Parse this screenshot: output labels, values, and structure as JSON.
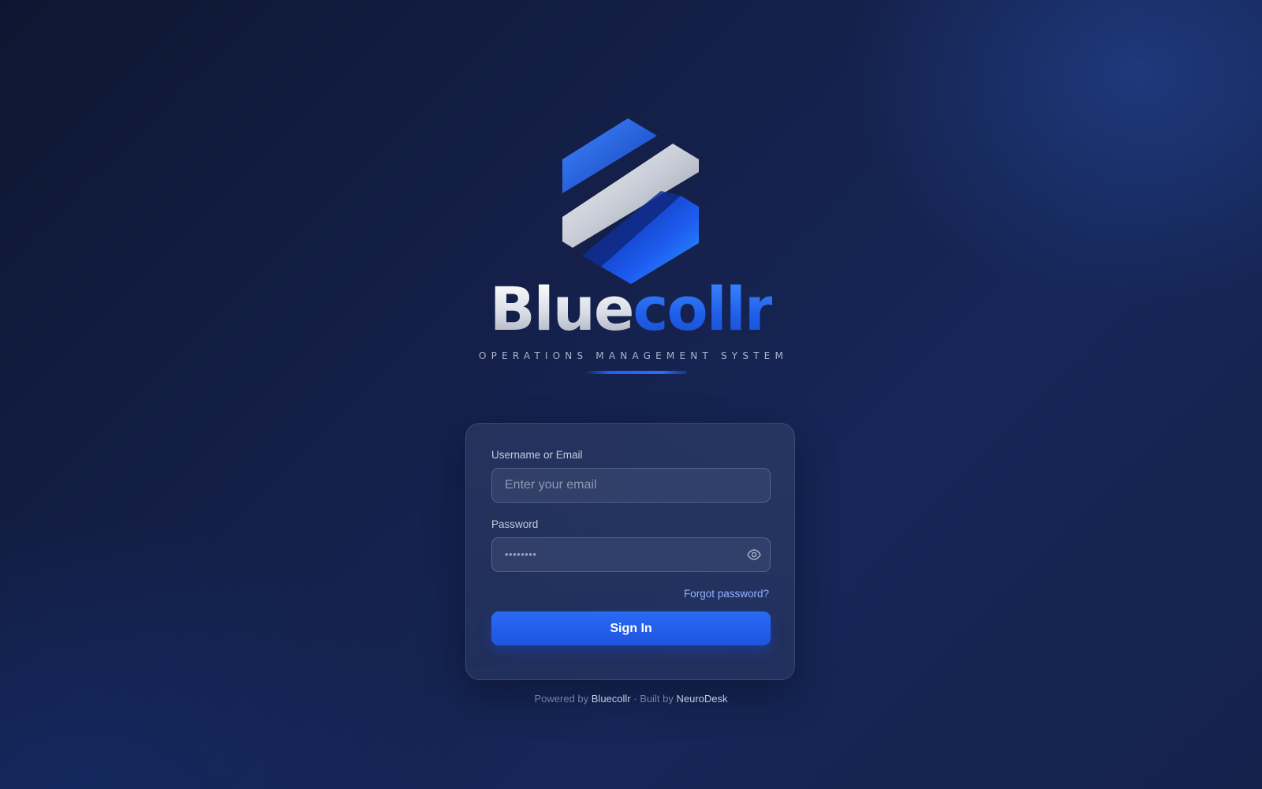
{
  "brand": {
    "wordmark_part_1": "Blue",
    "wordmark_part_2": "collr",
    "tagline": "OPERATIONS MANAGEMENT SYSTEM",
    "logo_icon": "hexagon-s-logo",
    "colors": {
      "accent_blue": "#1f62f0",
      "wordmark_silver": "#d9dde6",
      "background": "#141f47"
    }
  },
  "login_form": {
    "username_label": "Username or Email",
    "username_placeholder": "Enter your email",
    "username_value": "",
    "password_label": "Password",
    "password_mask": "••••••••",
    "password_visibility_icon": "eye-icon",
    "forgot_password_label": "Forgot password?",
    "sign_in_label": "Sign In"
  },
  "footer": {
    "powered_by_prefix": "Powered by",
    "powered_by_brand": "Bluecollr",
    "separator": "·",
    "built_by_prefix": "Built by",
    "built_by_brand": "NeuroDesk"
  }
}
